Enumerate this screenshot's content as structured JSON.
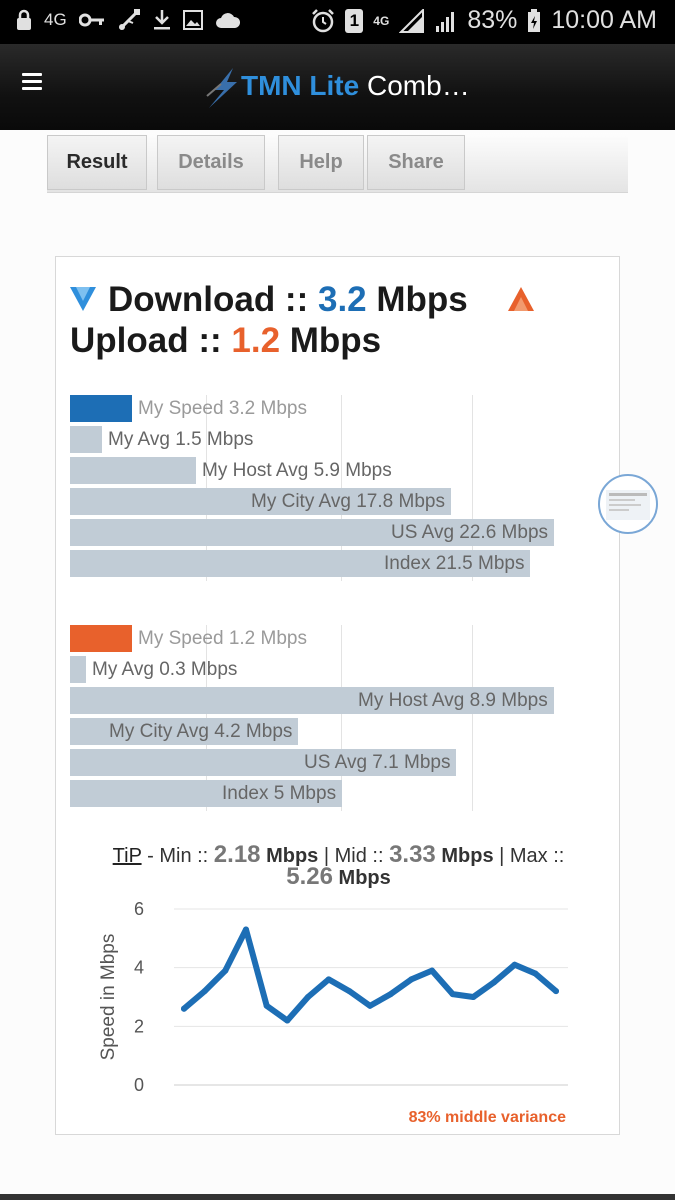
{
  "status_bar": {
    "network": "4G",
    "signal_type": "4G",
    "battery": "83%",
    "time": "10:00 AM",
    "sim_slot": "1",
    "icons": [
      "lock-icon",
      "key-icon",
      "usb-icon",
      "download-icon",
      "image-icon",
      "cloud-icon",
      "alarm-icon",
      "sim-icon",
      "signal-icon",
      "battery-icon"
    ]
  },
  "app_bar": {
    "brand": "TMN Lite",
    "title_rest": " Comb…",
    "accent": "#2f8fdc"
  },
  "tabs": [
    {
      "label": "Result",
      "active": true
    },
    {
      "label": "Details",
      "active": false
    },
    {
      "label": "Help",
      "active": false
    },
    {
      "label": "Share",
      "active": false
    }
  ],
  "summary": {
    "download_label": "Download ::",
    "download_value": "3.2",
    "upload_label": "Upload ::",
    "upload_value": "1.2",
    "unit": "Mbps",
    "download_color": "#1d6eb5",
    "upload_color": "#e8612c"
  },
  "download_bars": [
    {
      "label": "My Speed 3.2 Mbps",
      "value": 3.2
    },
    {
      "label": "My Avg 1.5 Mbps",
      "value": 1.5
    },
    {
      "label": "My Host Avg 5.9 Mbps",
      "value": 5.9
    },
    {
      "label": "My City Avg 17.8 Mbps",
      "value": 17.8
    },
    {
      "label": "US Avg 22.6 Mbps",
      "value": 22.6
    },
    {
      "label": "Index 21.5 Mbps",
      "value": 21.5
    }
  ],
  "upload_bars": [
    {
      "label": "My Speed 1.2 Mbps",
      "value": 1.2
    },
    {
      "label": "My Avg 0.3 Mbps",
      "value": 0.3
    },
    {
      "label": "My Host Avg 8.9 Mbps",
      "value": 8.9
    },
    {
      "label": "My City Avg 4.2 Mbps",
      "value": 4.2
    },
    {
      "label": "US Avg 7.1 Mbps",
      "value": 7.1
    },
    {
      "label": "Index 5 Mbps",
      "value": 5
    }
  ],
  "tip": {
    "label": "TiP",
    "min_label": " - Min :: ",
    "min": "2.18",
    "mid_label": " | Mid :: ",
    "mid": "3.33",
    "max_label": " | Max :: ",
    "max": "5.26",
    "unit": "Mbps"
  },
  "chart_data": {
    "type": "line",
    "ylabel": "Speed in Mbps",
    "xlabel": "",
    "ylim": [
      0,
      6
    ],
    "yticks": [
      0,
      2,
      4,
      6
    ],
    "grid": true,
    "series": [
      {
        "values": [
          2.6,
          3.2,
          3.9,
          5.3,
          2.7,
          2.2,
          3.0,
          3.6,
          3.2,
          2.7,
          3.1,
          3.6,
          3.9,
          3.1,
          3.0,
          3.5,
          4.1,
          3.8,
          3.2
        ]
      }
    ],
    "color": "#1d6eb5",
    "annotation": "83% middle variance"
  }
}
